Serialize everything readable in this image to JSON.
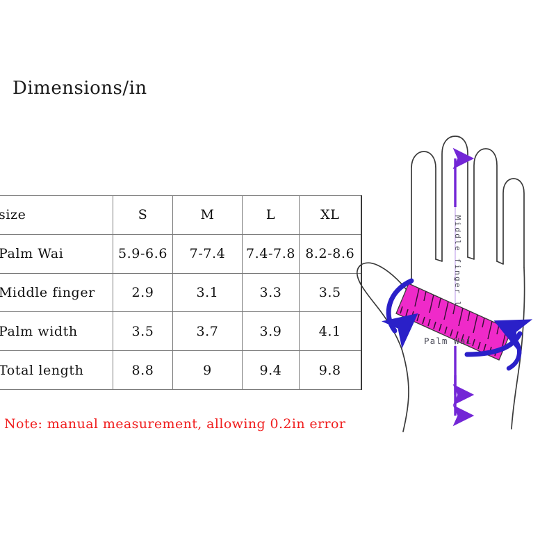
{
  "page": {
    "title": "Dimensions/in",
    "note": "Note: manual measurement, allowing 0.2in error",
    "note_color": "#f01e1e",
    "background": "#ffffff"
  },
  "table": {
    "columns": [
      "size",
      "S",
      "M",
      "L",
      "XL"
    ],
    "rows": [
      {
        "label": "Palm Wai",
        "values": [
          "5.9-6.6",
          "7-7.4",
          "7.4-7.8",
          "8.2-8.6"
        ]
      },
      {
        "label": "Middle finger",
        "values": [
          "2.9",
          "3.1",
          "3.3",
          "3.5"
        ]
      },
      {
        "label": "Palm width",
        "values": [
          "3.5",
          "3.7",
          "3.9",
          "4.1"
        ]
      },
      {
        "label": "Total length",
        "values": [
          "8.8",
          "9",
          "9.4",
          "9.8"
        ]
      }
    ],
    "border_color": "#7a7a7a"
  },
  "diagram": {
    "name": "hand-measurement-diagram",
    "middle_finger_label": "Middle finger length",
    "palm_wai_label": "Palm Wai",
    "colors": {
      "hand_outline": "#3a3a3a",
      "ruler": "#ef2ac9",
      "ruler_tick": "#4a1a44",
      "arrow_blue": "#2a20c8",
      "arrow_purple": "#7326d6",
      "label_text": "#4a4a58"
    }
  }
}
